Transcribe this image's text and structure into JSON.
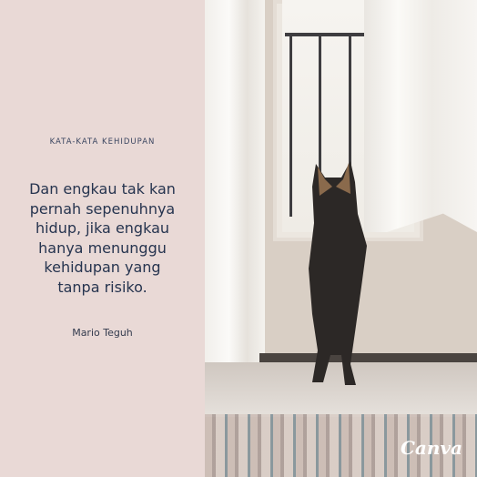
{
  "label": "KATA-KATA KEHIDUPAN",
  "quote_lines": [
    "Dan engkau tak kan",
    "pernah sepenuhnya",
    "hidup, jika engkau",
    "hanya menunggu",
    "kehidupan yang",
    "tanpa risiko."
  ],
  "author": "Mario Teguh",
  "logo": "Canva",
  "colors": {
    "panel": "#e9d9d6",
    "text": "#26344f"
  }
}
